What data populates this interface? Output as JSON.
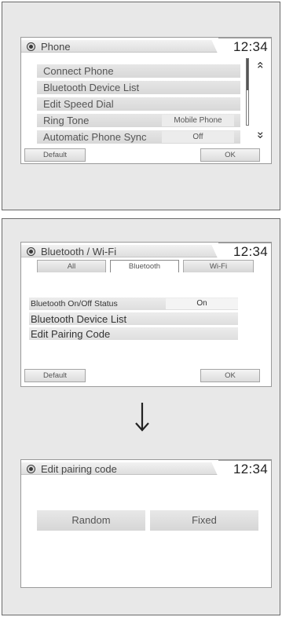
{
  "phone_screen": {
    "title": "Phone",
    "clock": "12:34",
    "menu": [
      {
        "label": "Connect Phone",
        "value": ""
      },
      {
        "label": "Bluetooth Device List",
        "value": ""
      },
      {
        "label": "Edit Speed Dial",
        "value": ""
      },
      {
        "label": "Ring Tone",
        "value": "Mobile Phone"
      },
      {
        "label": "Automatic Phone Sync",
        "value": "Off"
      }
    ],
    "scroll_up_icon": "double-chevron-up-icon",
    "scroll_down_icon": "double-chevron-down-icon",
    "default_label": "Default",
    "ok_label": "OK"
  },
  "bluetooth_screen": {
    "title": "Bluetooth / Wi-Fi",
    "clock": "12:34",
    "tabs": [
      {
        "label": "All",
        "active": false
      },
      {
        "label": "Bluetooth",
        "active": true
      },
      {
        "label": "Wi-Fi",
        "active": false
      }
    ],
    "menu": [
      {
        "label": "Bluetooth On/Off Status",
        "value": "On"
      },
      {
        "label": "Bluetooth Device List",
        "value": ""
      },
      {
        "label": "Edit Pairing Code",
        "value": ""
      }
    ],
    "default_label": "Default",
    "ok_label": "OK"
  },
  "transition_icon": "down-arrow-icon",
  "pairing_screen": {
    "title": "Edit pairing code",
    "clock": "12:34",
    "random_label": "Random",
    "fixed_label": "Fixed"
  }
}
